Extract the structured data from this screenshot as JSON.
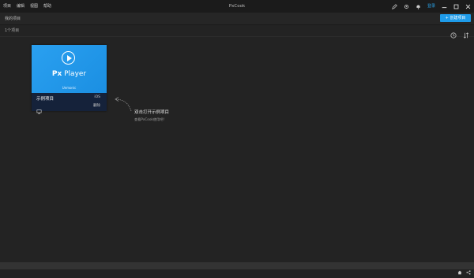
{
  "menu": [
    "项目",
    "编辑",
    "视图",
    "帮助"
  ],
  "app_title": "PxCook",
  "toolbar": {
    "login_label": "登录",
    "icons": [
      "pen-icon",
      "settings-icon",
      "bell-icon",
      "minimize-icon",
      "maximize-icon",
      "close-icon"
    ]
  },
  "subbar": {
    "title": "我的项目",
    "new_project_label": "+ 创建项目"
  },
  "project_count": "1个项目",
  "card": {
    "brand_px": "Px",
    "brand_player": " Player",
    "uemo": "Uemonic",
    "name": "示例项目",
    "platform": "iOS",
    "delete_label": "删除"
  },
  "hint": {
    "main": "双击打开示例项目",
    "sub": "查看PxCook使用吧!"
  },
  "colors": {
    "accent": "#1e9be9",
    "background": "#232323",
    "titlebar": "#1b1b1b",
    "card_thumb": "#1b8fe2"
  }
}
